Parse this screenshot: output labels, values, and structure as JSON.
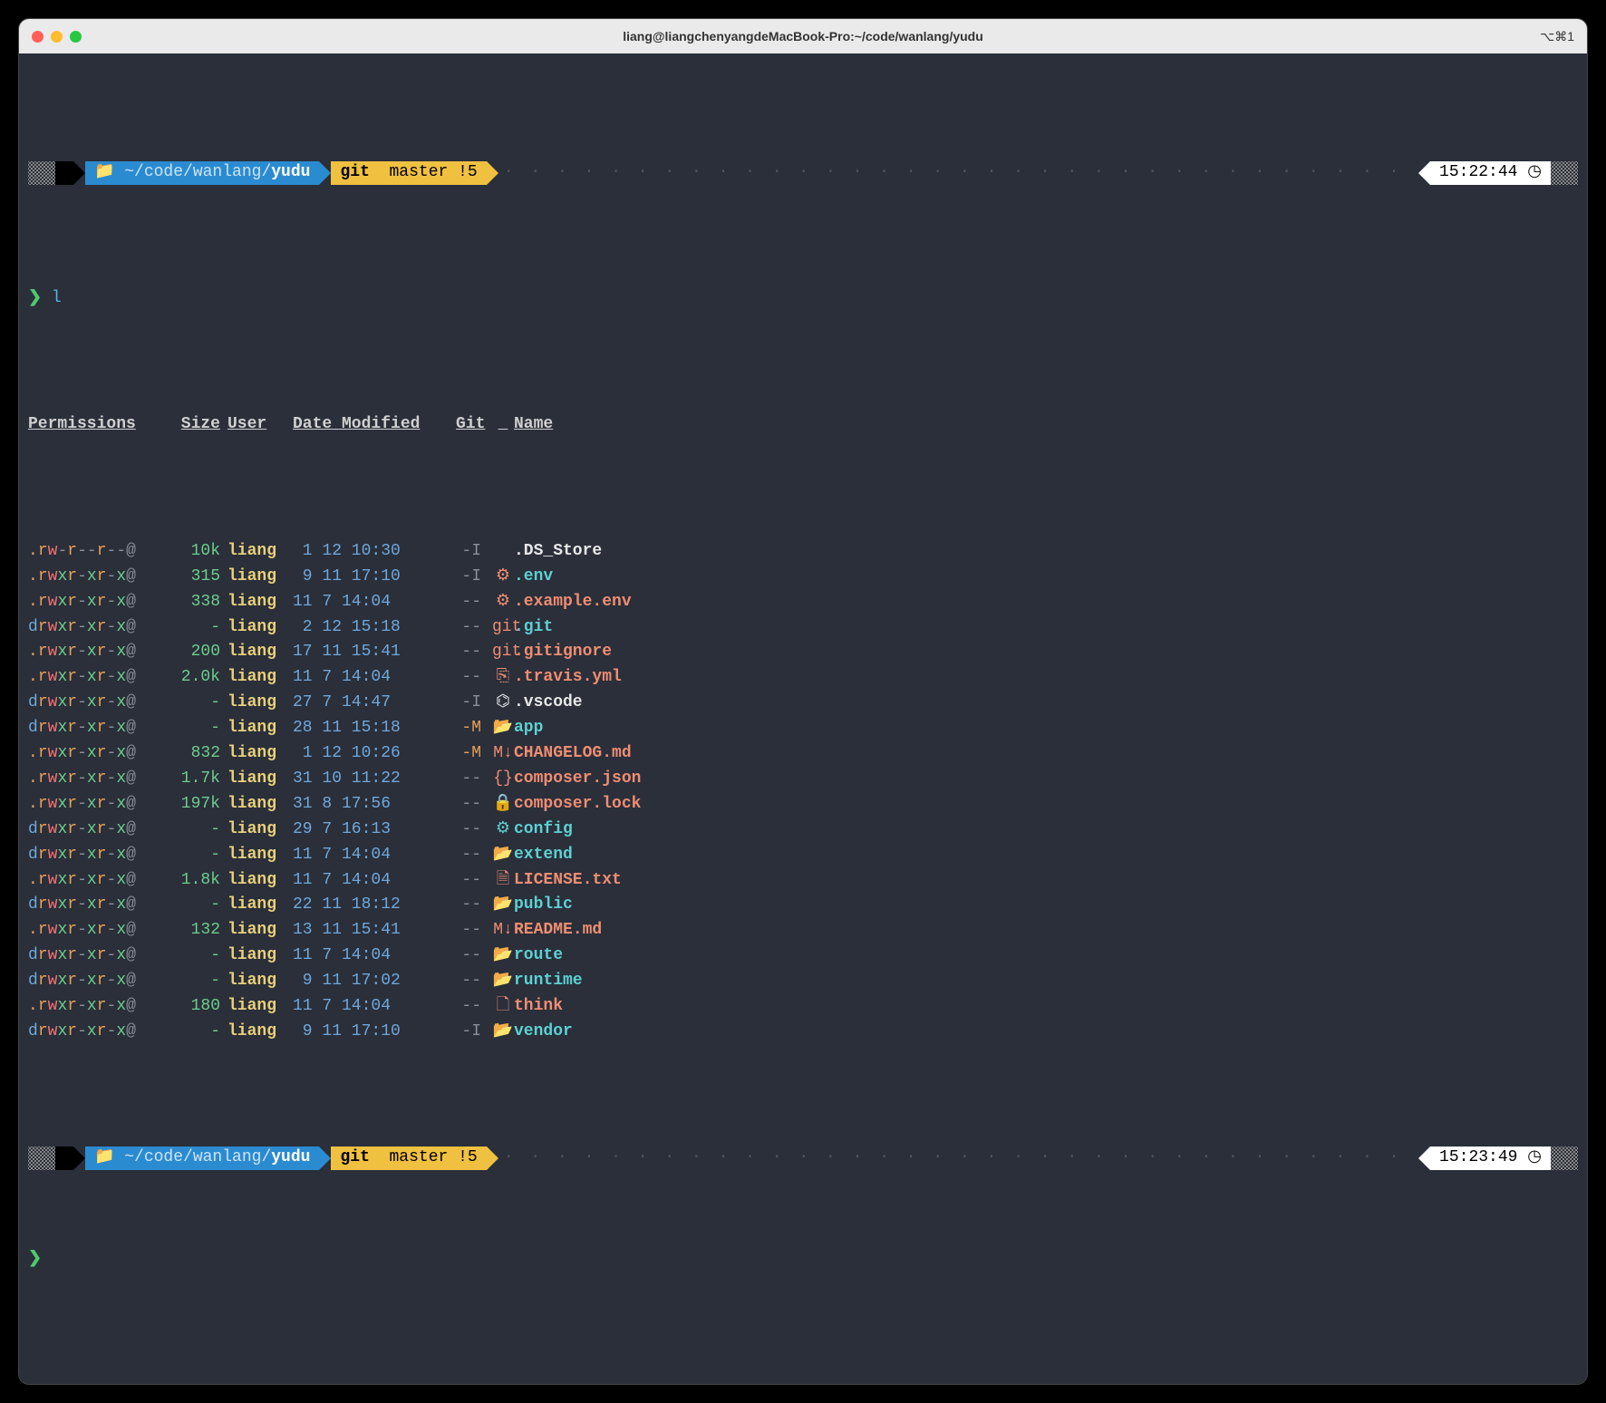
{
  "window": {
    "title": "liang@liangchenyangdeMacBook-Pro:~/code/wanlang/yudu",
    "shortcut": "⌥⌘1"
  },
  "prompt": {
    "apple": "",
    "folder_icon": "📁",
    "path_prefix": "~/code/wanlang/",
    "path_last": "yudu",
    "git_label": "git",
    "branch_icon": "",
    "branch": "master",
    "dirty": "!5",
    "time1": "15:22:44",
    "time2": "15:23:49",
    "clock": "◷",
    "sym": "❯",
    "cmd": "l"
  },
  "headers": {
    "perm": "Permissions",
    "size": "Size",
    "user": "User",
    "date": "Date Modified",
    "git": "Git",
    "name": "Name"
  },
  "rows": [
    {
      "perm": ".rw-r--r--@",
      "perm_type": "file",
      "size": "10k",
      "user": "liang",
      "date": " 1 12 10:30",
      "git": "-I",
      "icon": "",
      "icon_color": "white-t",
      "name": ".DS_Store",
      "name_color": "white-t"
    },
    {
      "perm": ".rwxr-xr-x@",
      "perm_type": "exec",
      "size": "315",
      "user": "liang",
      "date": " 9 11 17:10",
      "git": "-I",
      "icon": "⚙",
      "icon_color": "salmon",
      "name": ".env",
      "name_color": "cyan"
    },
    {
      "perm": ".rwxr-xr-x@",
      "perm_type": "exec",
      "size": "338",
      "user": "liang",
      "date": "11 7 14:04",
      "git": "--",
      "icon": "⚙",
      "icon_color": "salmon",
      "name": ".example.env",
      "name_color": "salmon"
    },
    {
      "perm": "drwxr-xr-x@",
      "perm_type": "dir",
      "size": "-",
      "user": "liang",
      "date": " 2 12 15:18",
      "git": "--",
      "icon": "git",
      "icon_color": "salmon",
      "name": ".git",
      "name_color": "cyan"
    },
    {
      "perm": ".rwxr-xr-x@",
      "perm_type": "exec",
      "size": "200",
      "user": "liang",
      "date": "17 11 15:41",
      "git": "--",
      "icon": "git",
      "icon_color": "salmon",
      "name": ".gitignore",
      "name_color": "salmon"
    },
    {
      "perm": ".rwxr-xr-x@",
      "perm_type": "exec",
      "size": "2.0k",
      "user": "liang",
      "date": "11 7 14:04",
      "git": "--",
      "icon": "⎘",
      "icon_color": "salmon",
      "name": ".travis.yml",
      "name_color": "salmon"
    },
    {
      "perm": "drwxr-xr-x@",
      "perm_type": "dir",
      "size": "-",
      "user": "liang",
      "date": "27 7 14:47",
      "git": "-I",
      "icon": "⌬",
      "icon_color": "white-t",
      "name": ".vscode",
      "name_color": "white-t"
    },
    {
      "perm": "drwxr-xr-x@",
      "perm_type": "dir",
      "size": "-",
      "user": "liang",
      "date": "28 11 15:18",
      "git": "-M",
      "icon": "📂",
      "icon_color": "cyan",
      "name": "app",
      "name_color": "cyan"
    },
    {
      "perm": ".rwxr-xr-x@",
      "perm_type": "exec",
      "size": "832",
      "user": "liang",
      "date": " 1 12 10:26",
      "git": "-M",
      "icon": "M↓",
      "icon_color": "salmon",
      "name": "CHANGELOG.md",
      "name_color": "salmon"
    },
    {
      "perm": ".rwxr-xr-x@",
      "perm_type": "exec",
      "size": "1.7k",
      "user": "liang",
      "date": "31 10 11:22",
      "git": "--",
      "icon": "{}",
      "icon_color": "salmon",
      "name": "composer.json",
      "name_color": "salmon"
    },
    {
      "perm": ".rwxr-xr-x@",
      "perm_type": "exec",
      "size": "197k",
      "user": "liang",
      "date": "31 8 17:56",
      "git": "--",
      "icon": "🔒",
      "icon_color": "salmon",
      "name": "composer.lock",
      "name_color": "salmon"
    },
    {
      "perm": "drwxr-xr-x@",
      "perm_type": "dir",
      "size": "-",
      "user": "liang",
      "date": "29 7 16:13",
      "git": "--",
      "icon": "⚙",
      "icon_color": "cyan",
      "name": "config",
      "name_color": "cyan"
    },
    {
      "perm": "drwxr-xr-x@",
      "perm_type": "dir",
      "size": "-",
      "user": "liang",
      "date": "11 7 14:04",
      "git": "--",
      "icon": "📂",
      "icon_color": "cyan",
      "name": "extend",
      "name_color": "cyan"
    },
    {
      "perm": ".rwxr-xr-x@",
      "perm_type": "exec",
      "size": "1.8k",
      "user": "liang",
      "date": "11 7 14:04",
      "git": "--",
      "icon": "🗎",
      "icon_color": "salmon",
      "name": "LICENSE.txt",
      "name_color": "salmon"
    },
    {
      "perm": "drwxr-xr-x@",
      "perm_type": "dir",
      "size": "-",
      "user": "liang",
      "date": "22 11 18:12",
      "git": "--",
      "icon": "📂",
      "icon_color": "cyan",
      "name": "public",
      "name_color": "cyan"
    },
    {
      "perm": ".rwxr-xr-x@",
      "perm_type": "exec",
      "size": "132",
      "user": "liang",
      "date": "13 11 15:41",
      "git": "--",
      "icon": "M↓",
      "icon_color": "salmon",
      "name": "README.md",
      "name_color": "salmon"
    },
    {
      "perm": "drwxr-xr-x@",
      "perm_type": "dir",
      "size": "-",
      "user": "liang",
      "date": "11 7 14:04",
      "git": "--",
      "icon": "📂",
      "icon_color": "cyan",
      "name": "route",
      "name_color": "cyan"
    },
    {
      "perm": "drwxr-xr-x@",
      "perm_type": "dir",
      "size": "-",
      "user": "liang",
      "date": " 9 11 17:02",
      "git": "--",
      "icon": "📂",
      "icon_color": "cyan",
      "name": "runtime",
      "name_color": "cyan"
    },
    {
      "perm": ".rwxr-xr-x@",
      "perm_type": "exec",
      "size": "180",
      "user": "liang",
      "date": "11 7 14:04",
      "git": "--",
      "icon": "🗋",
      "icon_color": "salmon",
      "name": "think",
      "name_color": "salmon"
    },
    {
      "perm": "drwxr-xr-x@",
      "perm_type": "dir",
      "size": "-",
      "user": "liang",
      "date": " 9 11 17:10",
      "git": "-I",
      "icon": "📂",
      "icon_color": "cyan",
      "name": "vendor",
      "name_color": "cyan"
    }
  ]
}
